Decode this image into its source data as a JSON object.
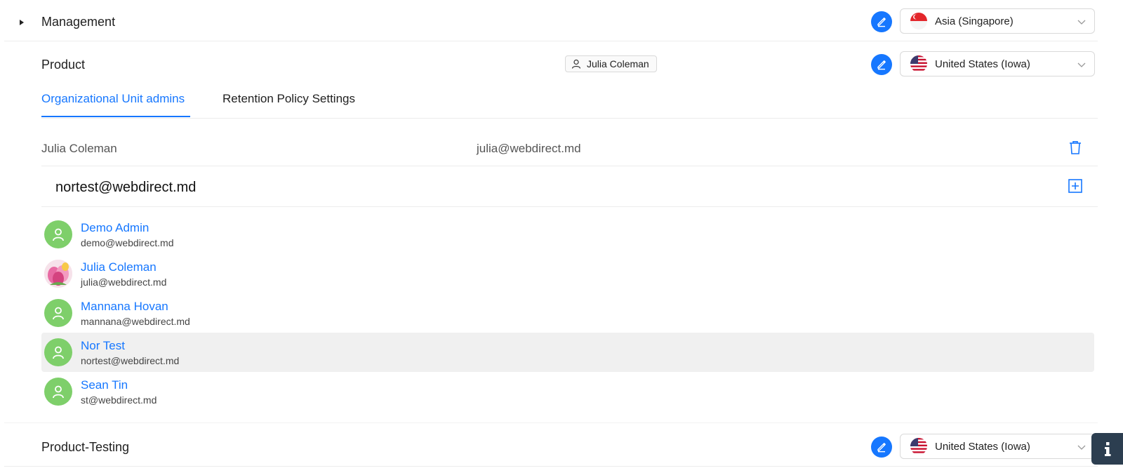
{
  "units": {
    "management": {
      "name": "Management",
      "region": "Asia (Singapore)"
    },
    "product": {
      "name": "Product",
      "owner": "Julia Coleman",
      "region": "United States (Iowa)"
    },
    "product_testing": {
      "name": "Product-Testing",
      "region": "United States (Iowa)"
    }
  },
  "tabs": [
    {
      "label": "Organizational Unit admins",
      "active": true
    },
    {
      "label": "Retention Policy Settings",
      "active": false
    }
  ],
  "admins": [
    {
      "name": "Julia Coleman",
      "email": "julia@webdirect.md"
    }
  ],
  "add_admin": {
    "search_value": "nortest@webdirect.md"
  },
  "user_options": [
    {
      "name": "Demo Admin",
      "email": "demo@webdirect.md",
      "avatar": "user-icon",
      "highlighted": false
    },
    {
      "name": "Julia Coleman",
      "email": "julia@webdirect.md",
      "avatar": "tulip-photo",
      "highlighted": false
    },
    {
      "name": "Mannana Hovan",
      "email": "mannana@webdirect.md",
      "avatar": "user-icon",
      "highlighted": false
    },
    {
      "name": "Nor Test",
      "email": "nortest@webdirect.md",
      "avatar": "user-icon",
      "highlighted": true
    },
    {
      "name": "Sean Tin",
      "email": "st@webdirect.md",
      "avatar": "user-icon",
      "highlighted": false
    }
  ],
  "colors": {
    "accent": "#1677ff",
    "avatar_green": "#7ecf6a",
    "info_button": "#2c3e50",
    "highlight_row": "#f0f0f0"
  }
}
